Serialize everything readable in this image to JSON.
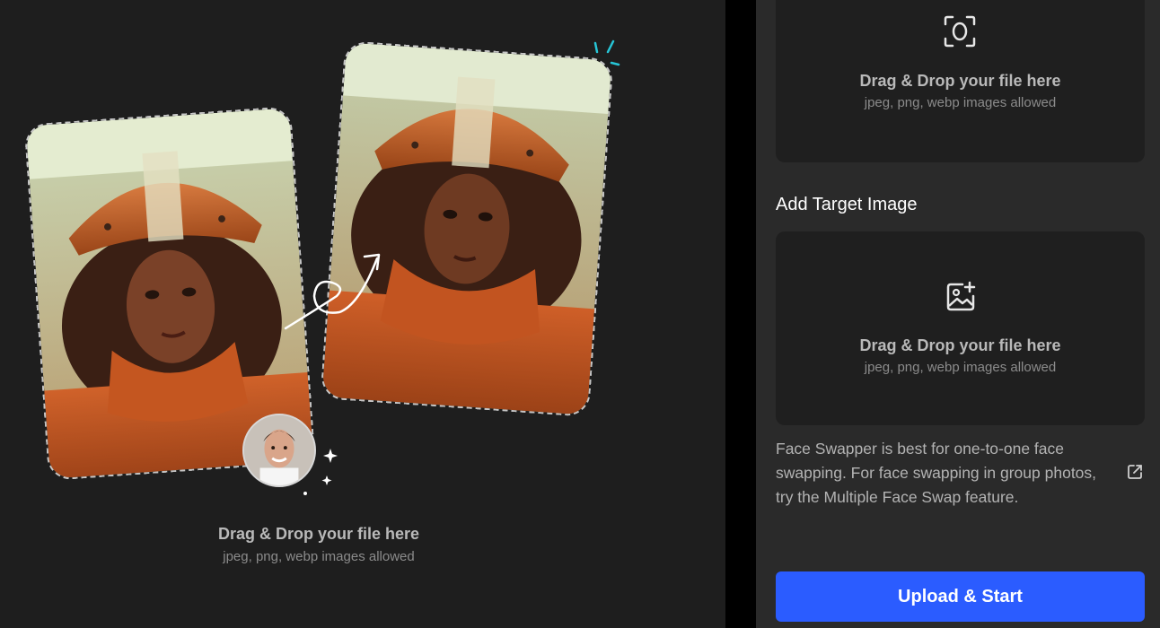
{
  "preview": {
    "dropzone": {
      "title": "Drag & Drop your file here",
      "subtitle": "jpeg, png, webp images allowed"
    }
  },
  "source_upload": {
    "icon": "face-scan-icon",
    "title": "Drag & Drop your file here",
    "subtitle": "jpeg, png, webp images allowed"
  },
  "target_upload": {
    "label": "Add Target Image",
    "icon": "image-plus-icon",
    "title": "Drag & Drop your file here",
    "subtitle": "jpeg, png, webp images allowed"
  },
  "info": {
    "text": "Face Swapper is best for one-to-one face swapping. For face swapping in group photos, try the Multiple Face Swap feature.",
    "link_icon": "external-link-icon"
  },
  "actions": {
    "upload_start": "Upload & Start"
  },
  "colors": {
    "accent": "#2b5cff",
    "sparkle": "#27c5d6",
    "panel": "#2a2a2a",
    "dropzone": "#1f1f1f"
  }
}
